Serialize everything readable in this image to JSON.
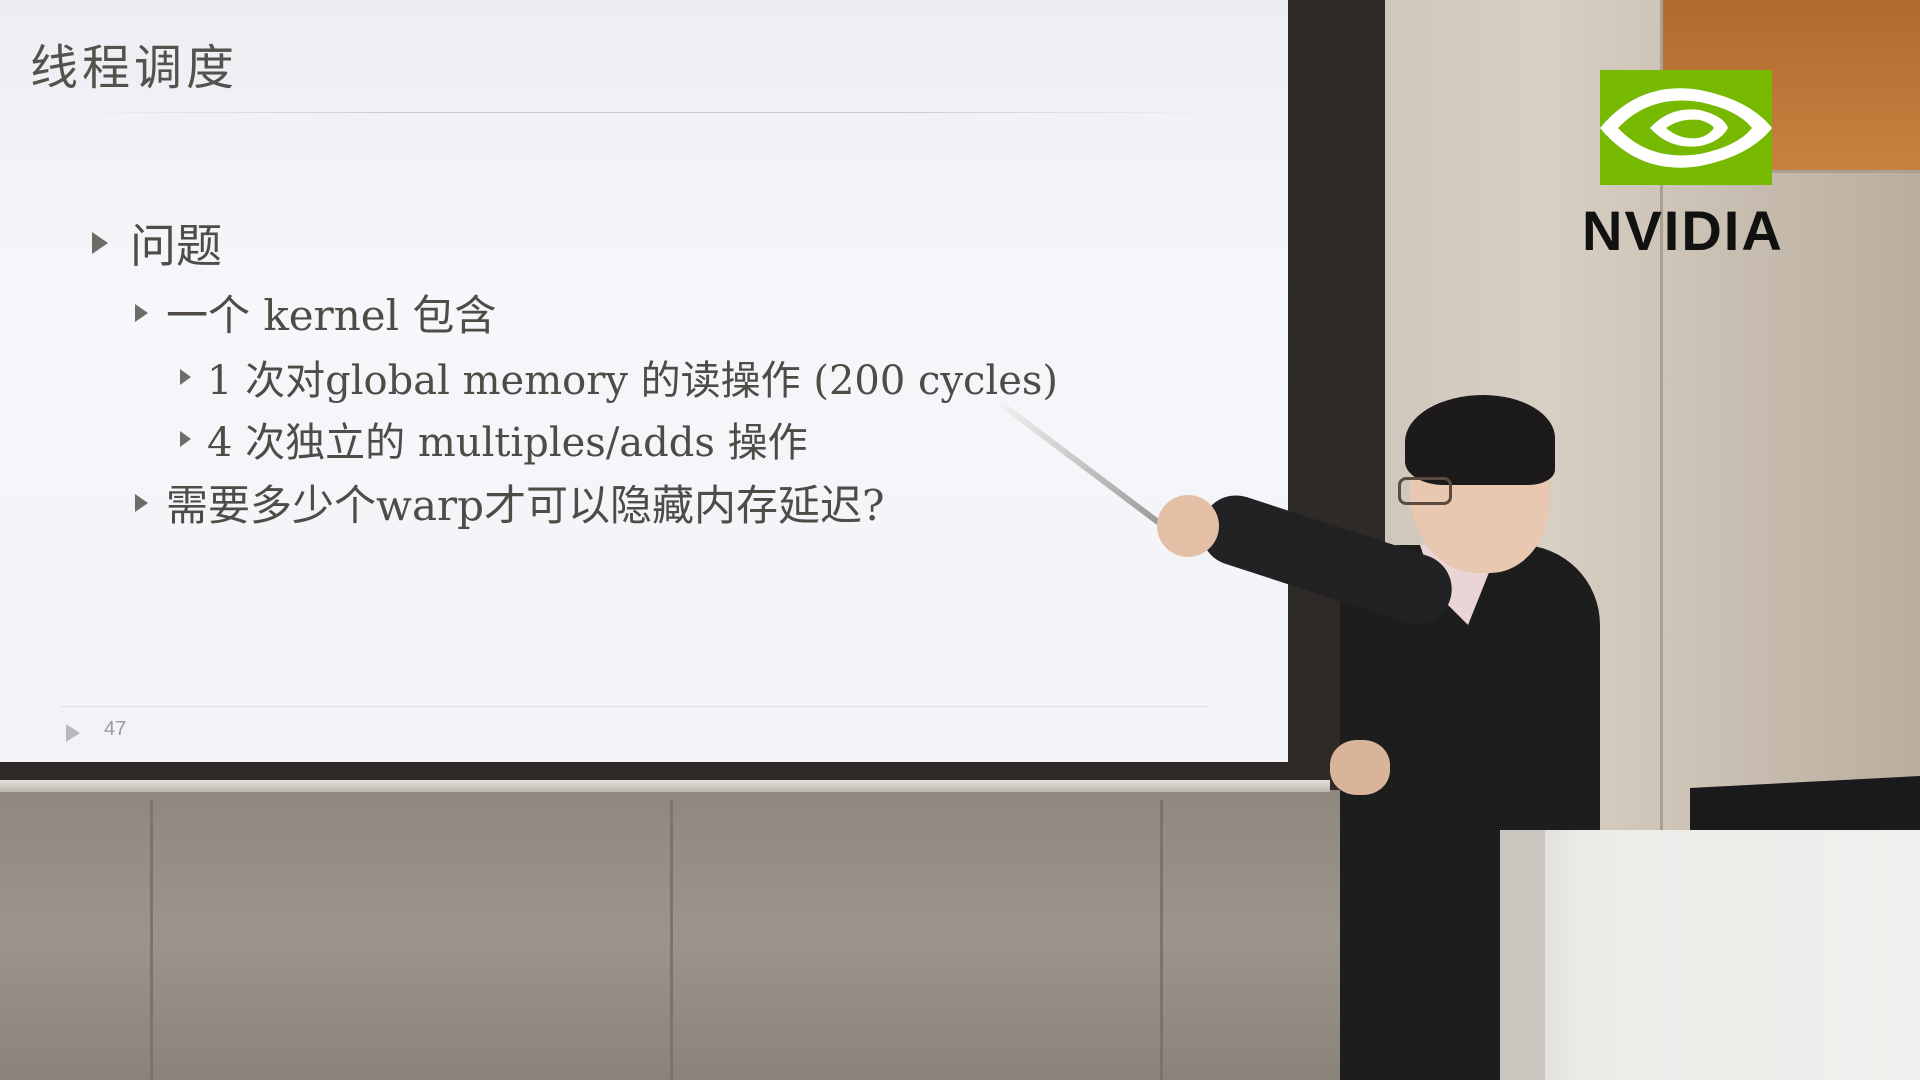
{
  "slide": {
    "title": "线程调度",
    "items": [
      {
        "level": 1,
        "text": "问题"
      },
      {
        "level": 2,
        "text": "一个 kernel 包含"
      },
      {
        "level": 3,
        "text": "1 次对global memory 的读操作 (200 cycles)"
      },
      {
        "level": 3,
        "text": "4 次独立的 multiples/adds 操作"
      },
      {
        "level": 2,
        "text": "需要多少个warp才可以隐藏内存延迟?"
      }
    ],
    "page_number": "47"
  },
  "logo": {
    "text": "NVIDIA",
    "color": "#76b900"
  }
}
